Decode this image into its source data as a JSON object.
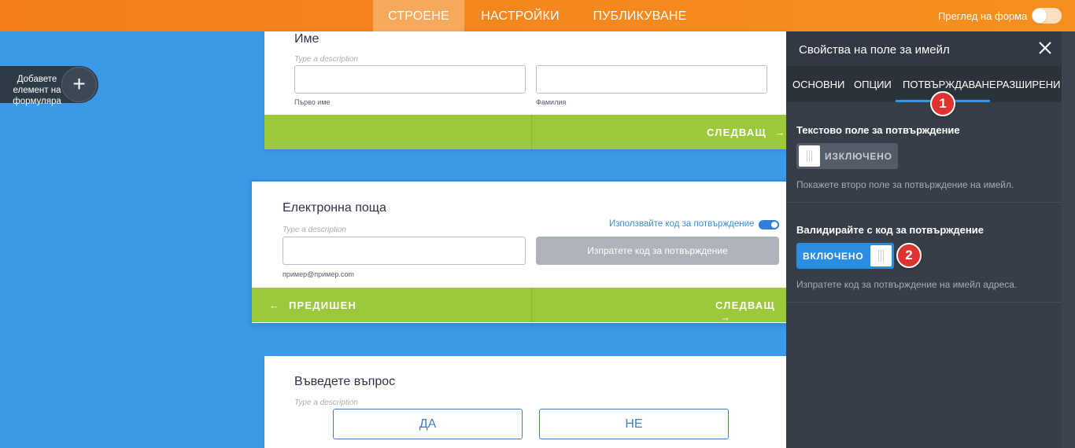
{
  "topbar": {
    "tabs": [
      "СТРОЕНЕ",
      "НАСТРОЙКИ",
      "ПУБЛИКУВАНЕ"
    ],
    "active_tab": "СТРОЕНЕ",
    "preview_label": "Преглед на форма",
    "preview_toggle": "off"
  },
  "add_element": {
    "label": "Добавете елемент на формуляра",
    "icon": "plus-icon"
  },
  "card_name": {
    "title": "Име",
    "description": "Type a description",
    "first_sublabel": "Първо име",
    "last_sublabel": "Фамилия",
    "next": "СЛЕДВАЩ"
  },
  "card_email": {
    "title": "Електронна поща",
    "description": "Type a description",
    "use_code_label": "Използвайте код за потвърждение",
    "send_code": "Изпратете код за потвърждение",
    "sublabel": "пример@пример.com",
    "prev": "ПРЕДИШЕН",
    "next": "СЛЕДВАЩ"
  },
  "card_question": {
    "title": "Въведете въпрос",
    "description": "Type a description",
    "yes": "ДА",
    "no": "НЕ"
  },
  "panel": {
    "title": "Свойства на поле за имейл",
    "tabs": [
      "ОСНОВНИ",
      "ОПЦИИ",
      "ПОТВЪРЖДАВАНЕ",
      "РАЗШИРЕНИ"
    ],
    "active_tab": "ПОТВЪРЖДАВАНЕ",
    "confirm_field": {
      "title": "Текстово поле за потвърждение",
      "state": "ИЗКЛЮЧЕНО",
      "note": "Покажете второ поле за потвърждение на имейл."
    },
    "validate_code": {
      "title": "Валидирайте с код за потвърждение",
      "state": "ВКЛЮЧЕНО",
      "note": "Изпратете код за потвърждение на имейл адреса."
    }
  },
  "badges": [
    "1",
    "2"
  ],
  "colors": {
    "topbar": "#f4891f",
    "canvas": "#3b9ae8",
    "green_bar": "#9cc83b",
    "panel": "#363e48",
    "accent_blue": "#2a8ee0",
    "badge_red": "#e0322f"
  }
}
